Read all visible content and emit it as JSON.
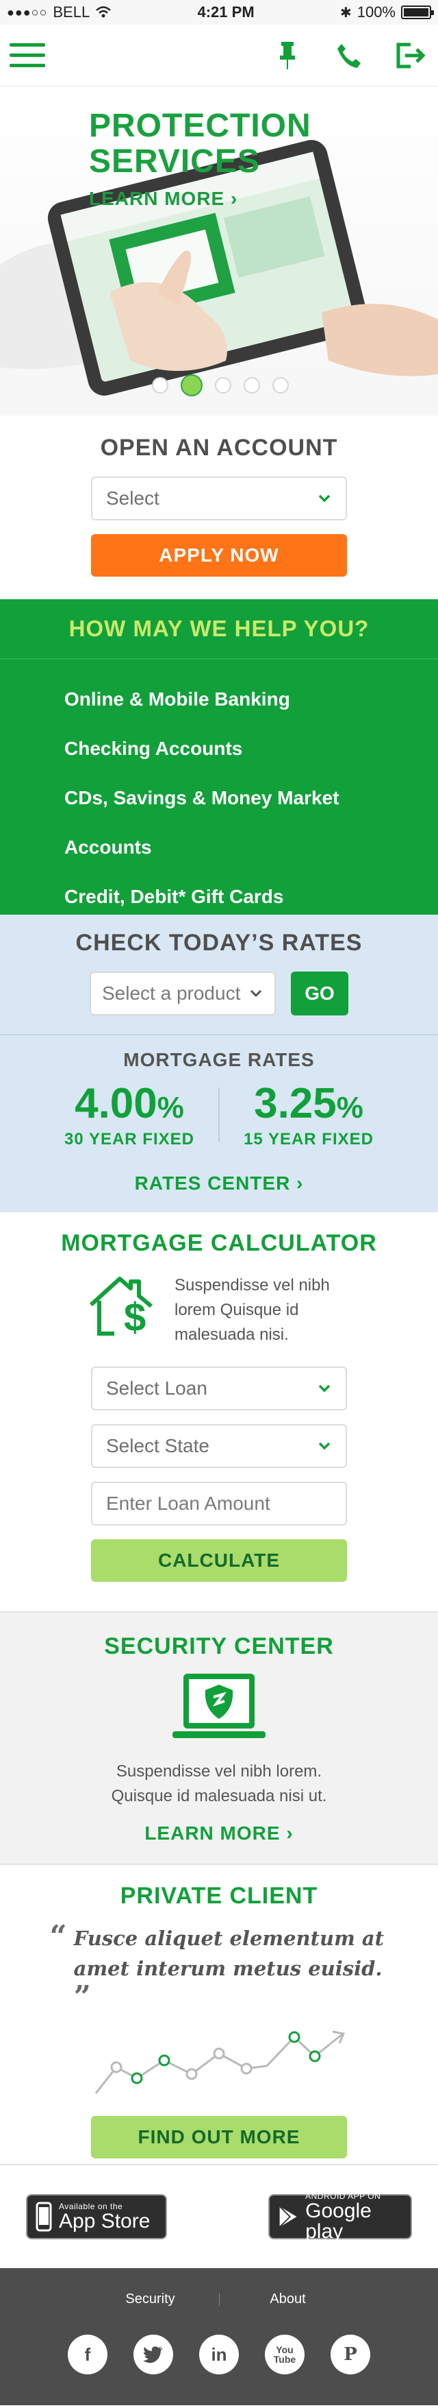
{
  "status_bar": {
    "carrier": "BELL",
    "time": "4:21 PM",
    "battery": "100%"
  },
  "header": {
    "menu_icon": "hamburger-menu-icon",
    "locator_icon": "pin-icon",
    "phone_icon": "phone-icon",
    "login_icon": "sign-in-icon"
  },
  "hero": {
    "title_line1": "PROTECTION",
    "title_line2": "SERVICES",
    "link": "LEARN MORE",
    "slides": 5,
    "active_slide": 2,
    "colors": {
      "accent": "#1aa13f"
    }
  },
  "open_account": {
    "title": "OPEN AN ACCOUNT",
    "select_value": "Select",
    "apply_label": "APPLY NOW"
  },
  "help": {
    "title": "HOW MAY WE HELP YOU?",
    "items": [
      {
        "label": "Online & Mobile Banking"
      },
      {
        "label": "Checking Accounts"
      },
      {
        "label": "CDs, Savings & Money Market"
      },
      {
        "label": "Accounts"
      },
      {
        "label": "Credit, Debit* Gift Cards"
      }
    ]
  },
  "rates": {
    "title": "CHECK TODAY’S RATES",
    "product_placeholder": "Select a product",
    "go_label": "GO",
    "mortgage_title": "MORTGAGE RATES",
    "fixed30": {
      "value": "4.00",
      "unit": "%",
      "label": "30 YEAR FIXED"
    },
    "fixed15": {
      "value": "3.25",
      "unit": "%",
      "label": "15 YEAR FIXED"
    },
    "center_link": "RATES CENTER"
  },
  "calculator": {
    "title": "MORTGAGE CALCULATOR",
    "text": "Suspendisse vel nibh lorem Quisque id malesuada nisi.",
    "loan_select": "Select Loan",
    "state_select": "Select State",
    "amount_placeholder": "Enter Loan Amount",
    "calculate_label": "CALCULATE"
  },
  "security": {
    "title": "SECURITY CENTER",
    "text_line1": "Suspendisse vel nibh lorem.",
    "text_line2": "Quisque id malesuada nisi ut.",
    "link": "LEARN MORE"
  },
  "private_client": {
    "title": "PRIVATE CLIENT",
    "quote": "Fusce aliquet elementum at amet interum metus euisid.",
    "open_quote": "“",
    "close_quote": "”",
    "cta": "FIND OUT MORE"
  },
  "apps": {
    "ios_small": "Available on the",
    "ios_big": "App Store",
    "android_small": "ANDROID APP ON",
    "android_big": "Google play"
  },
  "footer": {
    "links": [
      "Security",
      "About"
    ],
    "social": [
      "facebook-icon",
      "twitter-icon",
      "linkedin-icon",
      "youtube-icon",
      "pinterest-icon"
    ],
    "youtube_text": "You Tube"
  }
}
